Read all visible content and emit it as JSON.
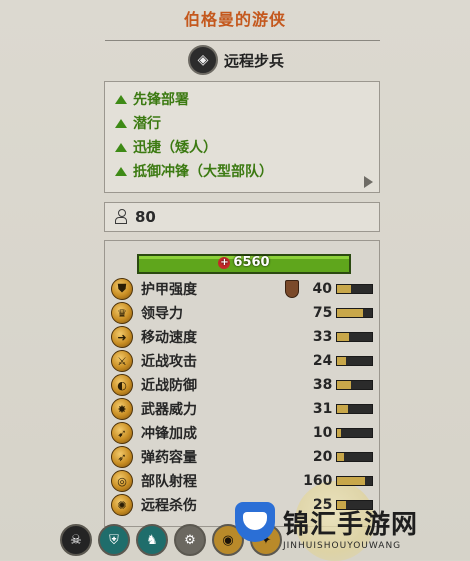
{
  "unit_name": "伯格曼的游侠",
  "unit_type": {
    "label": "远程步兵",
    "icon": "crosshair-icon"
  },
  "abilities": [
    {
      "label": "先锋部署",
      "icon": "green-triangle-icon"
    },
    {
      "label": "潜行",
      "icon": "green-triangle-icon"
    },
    {
      "label": "迅捷（矮人）",
      "icon": "green-triangle-icon"
    },
    {
      "label": "抵御冲锋（大型部队）",
      "icon": "green-triangle-icon"
    }
  ],
  "cost": {
    "value": "80",
    "icon": "unit-cost-icon"
  },
  "health": {
    "value": "6560"
  },
  "stats": [
    {
      "label": "护甲强度",
      "value": "40",
      "icon": "armour-icon",
      "shield": true,
      "fill": 0.4
    },
    {
      "label": "领导力",
      "value": "75",
      "icon": "leadership-icon",
      "fill": 0.75
    },
    {
      "label": "移动速度",
      "value": "33",
      "icon": "speed-icon",
      "fill": 0.33
    },
    {
      "label": "近战攻击",
      "value": "24",
      "icon": "melee-attack-icon",
      "fill": 0.24
    },
    {
      "label": "近战防御",
      "value": "38",
      "icon": "melee-defence-icon",
      "fill": 0.38
    },
    {
      "label": "武器威力",
      "value": "31",
      "icon": "weapon-strength-icon",
      "fill": 0.31
    },
    {
      "label": "冲锋加成",
      "value": "10",
      "icon": "charge-bonus-icon",
      "fill": 0.1
    },
    {
      "label": "弹药容量",
      "value": "20",
      "icon": "ammunition-icon",
      "fill": 0.2
    },
    {
      "label": "部队射程",
      "value": "160",
      "icon": "range-icon",
      "fill": 0.8
    },
    {
      "label": "远程杀伤",
      "value": "25",
      "icon": "missile-damage-icon",
      "fill": 0.25
    }
  ],
  "bottom_icons": [
    "skull-icon",
    "shield-icon",
    "deer-icon",
    "gear-icon",
    "eye-icon",
    "ability-icon"
  ],
  "watermark": {
    "title": "锦汇手游网",
    "subtitle": "JINHUISHOUYOUWANG"
  }
}
